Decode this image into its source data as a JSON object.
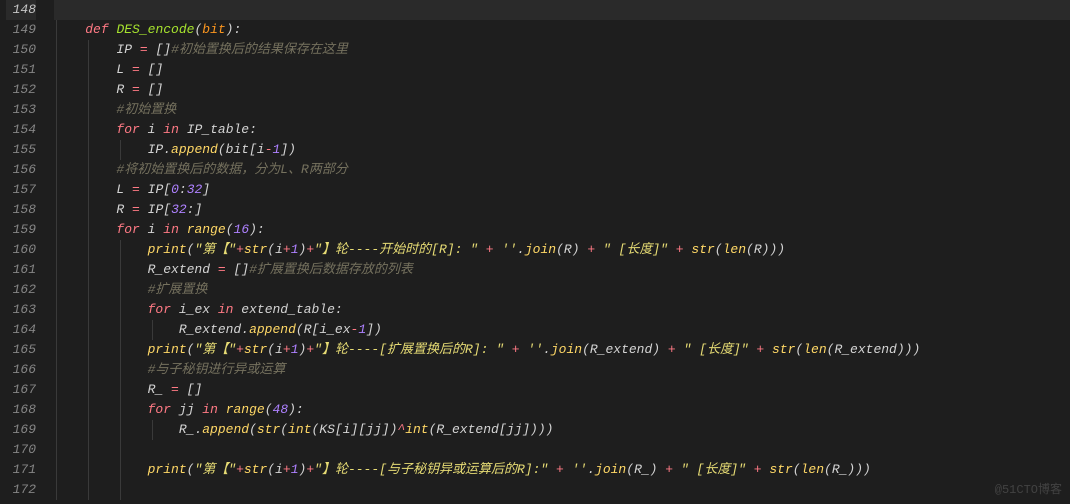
{
  "watermark": "@51CTO博客",
  "lines": [
    {
      "num": 148,
      "hl": true,
      "indent": 0,
      "tokens": []
    },
    {
      "num": 149,
      "hl": false,
      "indent": 1,
      "tokens": [
        {
          "t": "kw",
          "v": "def"
        },
        {
          "t": "sp",
          "v": " "
        },
        {
          "t": "id",
          "v": "DES_encode"
        },
        {
          "t": "br",
          "v": "("
        },
        {
          "t": "param",
          "v": "bit"
        },
        {
          "t": "br",
          "v": ")"
        },
        {
          "t": "br",
          "v": ":"
        }
      ]
    },
    {
      "num": 150,
      "hl": false,
      "indent": 2,
      "tokens": [
        {
          "t": "name",
          "v": "IP "
        },
        {
          "t": "op",
          "v": "="
        },
        {
          "t": "name",
          "v": " "
        },
        {
          "t": "br",
          "v": "[]"
        },
        {
          "t": "cmt",
          "v": "#初始置换后的结果保存在这里"
        }
      ]
    },
    {
      "num": 151,
      "hl": false,
      "indent": 2,
      "tokens": [
        {
          "t": "name",
          "v": "L "
        },
        {
          "t": "op",
          "v": "="
        },
        {
          "t": "name",
          "v": " "
        },
        {
          "t": "br",
          "v": "[]"
        }
      ]
    },
    {
      "num": 152,
      "hl": false,
      "indent": 2,
      "tokens": [
        {
          "t": "name",
          "v": "R "
        },
        {
          "t": "op",
          "v": "="
        },
        {
          "t": "name",
          "v": " "
        },
        {
          "t": "br",
          "v": "[]"
        }
      ]
    },
    {
      "num": 153,
      "hl": false,
      "indent": 2,
      "tokens": [
        {
          "t": "cmt",
          "v": "#初始置换"
        }
      ]
    },
    {
      "num": 154,
      "hl": false,
      "indent": 2,
      "tokens": [
        {
          "t": "kw",
          "v": "for"
        },
        {
          "t": "sp",
          "v": " "
        },
        {
          "t": "name",
          "v": "i"
        },
        {
          "t": "sp",
          "v": " "
        },
        {
          "t": "kw",
          "v": "in"
        },
        {
          "t": "sp",
          "v": " "
        },
        {
          "t": "name",
          "v": "IP_table"
        },
        {
          "t": "br",
          "v": ":"
        }
      ]
    },
    {
      "num": 155,
      "hl": false,
      "indent": 3,
      "tokens": [
        {
          "t": "name",
          "v": "IP"
        },
        {
          "t": "br",
          "v": "."
        },
        {
          "t": "call",
          "v": "append"
        },
        {
          "t": "br",
          "v": "("
        },
        {
          "t": "name",
          "v": "bit"
        },
        {
          "t": "br",
          "v": "["
        },
        {
          "t": "name",
          "v": "i"
        },
        {
          "t": "op",
          "v": "-"
        },
        {
          "t": "num",
          "v": "1"
        },
        {
          "t": "br",
          "v": "])"
        }
      ]
    },
    {
      "num": 156,
      "hl": false,
      "indent": 2,
      "tokens": [
        {
          "t": "cmt",
          "v": "#将初始置换后的数据，分为L、R两部分"
        }
      ]
    },
    {
      "num": 157,
      "hl": false,
      "indent": 2,
      "tokens": [
        {
          "t": "name",
          "v": "L "
        },
        {
          "t": "op",
          "v": "="
        },
        {
          "t": "name",
          "v": " IP"
        },
        {
          "t": "br",
          "v": "["
        },
        {
          "t": "num",
          "v": "0"
        },
        {
          "t": "br",
          "v": ":"
        },
        {
          "t": "num",
          "v": "32"
        },
        {
          "t": "br",
          "v": "]"
        }
      ]
    },
    {
      "num": 158,
      "hl": false,
      "indent": 2,
      "tokens": [
        {
          "t": "name",
          "v": "R "
        },
        {
          "t": "op",
          "v": "="
        },
        {
          "t": "name",
          "v": " IP"
        },
        {
          "t": "br",
          "v": "["
        },
        {
          "t": "num",
          "v": "32"
        },
        {
          "t": "br",
          "v": ":]"
        }
      ]
    },
    {
      "num": 159,
      "hl": false,
      "indent": 2,
      "tokens": [
        {
          "t": "kw",
          "v": "for"
        },
        {
          "t": "sp",
          "v": " "
        },
        {
          "t": "name",
          "v": "i"
        },
        {
          "t": "sp",
          "v": " "
        },
        {
          "t": "kw",
          "v": "in"
        },
        {
          "t": "sp",
          "v": " "
        },
        {
          "t": "call",
          "v": "range"
        },
        {
          "t": "br",
          "v": "("
        },
        {
          "t": "num",
          "v": "16"
        },
        {
          "t": "br",
          "v": "):"
        }
      ]
    },
    {
      "num": 160,
      "hl": false,
      "indent": 3,
      "tokens": [
        {
          "t": "call",
          "v": "print"
        },
        {
          "t": "br",
          "v": "("
        },
        {
          "t": "str",
          "v": "\"第【\""
        },
        {
          "t": "op",
          "v": "+"
        },
        {
          "t": "call",
          "v": "str"
        },
        {
          "t": "br",
          "v": "("
        },
        {
          "t": "name",
          "v": "i"
        },
        {
          "t": "op",
          "v": "+"
        },
        {
          "t": "num",
          "v": "1"
        },
        {
          "t": "br",
          "v": ")"
        },
        {
          "t": "op",
          "v": "+"
        },
        {
          "t": "str",
          "v": "\"】轮----开始时的[R]: \""
        },
        {
          "t": "sp",
          "v": " "
        },
        {
          "t": "op",
          "v": "+"
        },
        {
          "t": "sp",
          "v": " "
        },
        {
          "t": "str",
          "v": "''"
        },
        {
          "t": "br",
          "v": "."
        },
        {
          "t": "call",
          "v": "join"
        },
        {
          "t": "br",
          "v": "("
        },
        {
          "t": "name",
          "v": "R"
        },
        {
          "t": "br",
          "v": ")"
        },
        {
          "t": "sp",
          "v": " "
        },
        {
          "t": "op",
          "v": "+"
        },
        {
          "t": "sp",
          "v": " "
        },
        {
          "t": "str",
          "v": "\" [长度]\""
        },
        {
          "t": "sp",
          "v": " "
        },
        {
          "t": "op",
          "v": "+"
        },
        {
          "t": "sp",
          "v": " "
        },
        {
          "t": "call",
          "v": "str"
        },
        {
          "t": "br",
          "v": "("
        },
        {
          "t": "call",
          "v": "len"
        },
        {
          "t": "br",
          "v": "("
        },
        {
          "t": "name",
          "v": "R"
        },
        {
          "t": "br",
          "v": ")))"
        }
      ]
    },
    {
      "num": 161,
      "hl": false,
      "indent": 3,
      "tokens": [
        {
          "t": "name",
          "v": "R_extend "
        },
        {
          "t": "op",
          "v": "="
        },
        {
          "t": "name",
          "v": " "
        },
        {
          "t": "br",
          "v": "[]"
        },
        {
          "t": "cmt",
          "v": "#扩展置换后数据存放的列表"
        }
      ]
    },
    {
      "num": 162,
      "hl": false,
      "indent": 3,
      "tokens": [
        {
          "t": "cmt",
          "v": "#扩展置换"
        }
      ]
    },
    {
      "num": 163,
      "hl": false,
      "indent": 3,
      "tokens": [
        {
          "t": "kw",
          "v": "for"
        },
        {
          "t": "sp",
          "v": " "
        },
        {
          "t": "name",
          "v": "i_ex"
        },
        {
          "t": "sp",
          "v": " "
        },
        {
          "t": "kw",
          "v": "in"
        },
        {
          "t": "sp",
          "v": " "
        },
        {
          "t": "name",
          "v": "extend_table"
        },
        {
          "t": "br",
          "v": ":"
        }
      ]
    },
    {
      "num": 164,
      "hl": false,
      "indent": 4,
      "tokens": [
        {
          "t": "name",
          "v": "R_extend"
        },
        {
          "t": "br",
          "v": "."
        },
        {
          "t": "call",
          "v": "append"
        },
        {
          "t": "br",
          "v": "("
        },
        {
          "t": "name",
          "v": "R"
        },
        {
          "t": "br",
          "v": "["
        },
        {
          "t": "name",
          "v": "i_ex"
        },
        {
          "t": "op",
          "v": "-"
        },
        {
          "t": "num",
          "v": "1"
        },
        {
          "t": "br",
          "v": "])"
        }
      ]
    },
    {
      "num": 165,
      "hl": false,
      "indent": 3,
      "tokens": [
        {
          "t": "call",
          "v": "print"
        },
        {
          "t": "br",
          "v": "("
        },
        {
          "t": "str",
          "v": "\"第【\""
        },
        {
          "t": "op",
          "v": "+"
        },
        {
          "t": "call",
          "v": "str"
        },
        {
          "t": "br",
          "v": "("
        },
        {
          "t": "name",
          "v": "i"
        },
        {
          "t": "op",
          "v": "+"
        },
        {
          "t": "num",
          "v": "1"
        },
        {
          "t": "br",
          "v": ")"
        },
        {
          "t": "op",
          "v": "+"
        },
        {
          "t": "str",
          "v": "\"】轮----[扩展置换后的R]: \""
        },
        {
          "t": "sp",
          "v": " "
        },
        {
          "t": "op",
          "v": "+"
        },
        {
          "t": "sp",
          "v": " "
        },
        {
          "t": "str",
          "v": "''"
        },
        {
          "t": "br",
          "v": "."
        },
        {
          "t": "call",
          "v": "join"
        },
        {
          "t": "br",
          "v": "("
        },
        {
          "t": "name",
          "v": "R_extend"
        },
        {
          "t": "br",
          "v": ")"
        },
        {
          "t": "sp",
          "v": " "
        },
        {
          "t": "op",
          "v": "+"
        },
        {
          "t": "sp",
          "v": " "
        },
        {
          "t": "str",
          "v": "\" [长度]\""
        },
        {
          "t": "sp",
          "v": " "
        },
        {
          "t": "op",
          "v": "+"
        },
        {
          "t": "sp",
          "v": " "
        },
        {
          "t": "call",
          "v": "str"
        },
        {
          "t": "br",
          "v": "("
        },
        {
          "t": "call",
          "v": "len"
        },
        {
          "t": "br",
          "v": "("
        },
        {
          "t": "name",
          "v": "R_extend"
        },
        {
          "t": "br",
          "v": ")))"
        }
      ]
    },
    {
      "num": 166,
      "hl": false,
      "indent": 3,
      "tokens": [
        {
          "t": "cmt",
          "v": "#与子秘钥进行异或运算"
        }
      ]
    },
    {
      "num": 167,
      "hl": false,
      "indent": 3,
      "tokens": [
        {
          "t": "name",
          "v": "R_ "
        },
        {
          "t": "op",
          "v": "="
        },
        {
          "t": "name",
          "v": " "
        },
        {
          "t": "br",
          "v": "[]"
        }
      ]
    },
    {
      "num": 168,
      "hl": false,
      "indent": 3,
      "tokens": [
        {
          "t": "kw",
          "v": "for"
        },
        {
          "t": "sp",
          "v": " "
        },
        {
          "t": "name",
          "v": "jj"
        },
        {
          "t": "sp",
          "v": " "
        },
        {
          "t": "kw",
          "v": "in"
        },
        {
          "t": "sp",
          "v": " "
        },
        {
          "t": "call",
          "v": "range"
        },
        {
          "t": "br",
          "v": "("
        },
        {
          "t": "num",
          "v": "48"
        },
        {
          "t": "br",
          "v": "):"
        }
      ]
    },
    {
      "num": 169,
      "hl": false,
      "indent": 4,
      "tokens": [
        {
          "t": "name",
          "v": "R_"
        },
        {
          "t": "br",
          "v": "."
        },
        {
          "t": "call",
          "v": "append"
        },
        {
          "t": "br",
          "v": "("
        },
        {
          "t": "call",
          "v": "str"
        },
        {
          "t": "br",
          "v": "("
        },
        {
          "t": "call",
          "v": "int"
        },
        {
          "t": "br",
          "v": "("
        },
        {
          "t": "name",
          "v": "KS"
        },
        {
          "t": "br",
          "v": "["
        },
        {
          "t": "name",
          "v": "i"
        },
        {
          "t": "br",
          "v": "]["
        },
        {
          "t": "name",
          "v": "jj"
        },
        {
          "t": "br",
          "v": "])"
        },
        {
          "t": "op",
          "v": "^"
        },
        {
          "t": "call",
          "v": "int"
        },
        {
          "t": "br",
          "v": "("
        },
        {
          "t": "name",
          "v": "R_extend"
        },
        {
          "t": "br",
          "v": "["
        },
        {
          "t": "name",
          "v": "jj"
        },
        {
          "t": "br",
          "v": "])))"
        }
      ]
    },
    {
      "num": 170,
      "hl": false,
      "indent": 3,
      "tokens": []
    },
    {
      "num": 171,
      "hl": false,
      "indent": 3,
      "tokens": [
        {
          "t": "call",
          "v": "print"
        },
        {
          "t": "br",
          "v": "("
        },
        {
          "t": "str",
          "v": "\"第【\""
        },
        {
          "t": "op",
          "v": "+"
        },
        {
          "t": "call",
          "v": "str"
        },
        {
          "t": "br",
          "v": "("
        },
        {
          "t": "name",
          "v": "i"
        },
        {
          "t": "op",
          "v": "+"
        },
        {
          "t": "num",
          "v": "1"
        },
        {
          "t": "br",
          "v": ")"
        },
        {
          "t": "op",
          "v": "+"
        },
        {
          "t": "str",
          "v": "\"】轮----[与子秘钥异或运算后的R]:\""
        },
        {
          "t": "sp",
          "v": " "
        },
        {
          "t": "op",
          "v": "+"
        },
        {
          "t": "sp",
          "v": " "
        },
        {
          "t": "str",
          "v": "''"
        },
        {
          "t": "br",
          "v": "."
        },
        {
          "t": "call",
          "v": "join"
        },
        {
          "t": "br",
          "v": "("
        },
        {
          "t": "name",
          "v": "R_"
        },
        {
          "t": "br",
          "v": ")"
        },
        {
          "t": "sp",
          "v": " "
        },
        {
          "t": "op",
          "v": "+"
        },
        {
          "t": "sp",
          "v": " "
        },
        {
          "t": "str",
          "v": "\" [长度]\""
        },
        {
          "t": "sp",
          "v": " "
        },
        {
          "t": "op",
          "v": "+"
        },
        {
          "t": "sp",
          "v": " "
        },
        {
          "t": "call",
          "v": "str"
        },
        {
          "t": "br",
          "v": "("
        },
        {
          "t": "call",
          "v": "len"
        },
        {
          "t": "br",
          "v": "("
        },
        {
          "t": "name",
          "v": "R_"
        },
        {
          "t": "br",
          "v": ")))"
        }
      ]
    },
    {
      "num": 172,
      "hl": false,
      "indent": 3,
      "tokens": []
    }
  ]
}
